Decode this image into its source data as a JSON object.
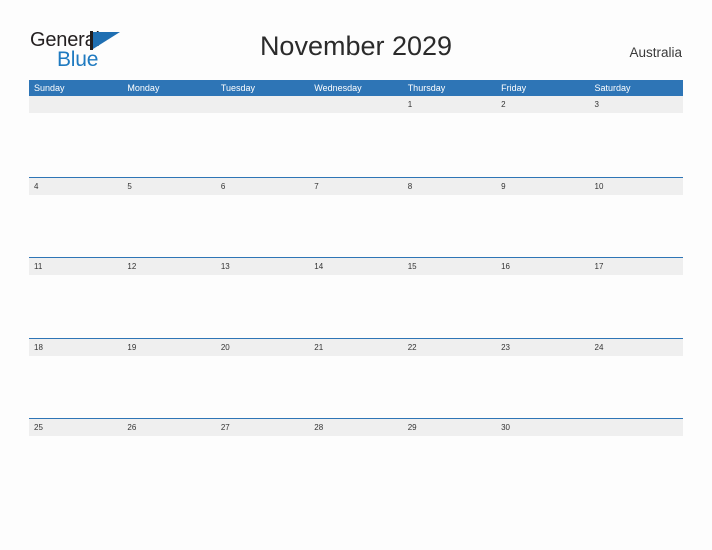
{
  "brand": {
    "name_part1": "General",
    "name_part2": "Blue",
    "triangle_color": "#1f6fb2",
    "blue_text_color": "#1f7ac0"
  },
  "header": {
    "title": "November 2029",
    "region": "Australia"
  },
  "theme": {
    "header_blue": "#2E75B6",
    "rule_blue": "#2E75B6",
    "date_band_gray": "#efefef",
    "page_background": "#fdfdfd",
    "date_text": "#333333",
    "weekday_text": "#ffffff"
  },
  "calendar": {
    "weekday_labels": [
      "Sunday",
      "Monday",
      "Tuesday",
      "Wednesday",
      "Thursday",
      "Friday",
      "Saturday"
    ],
    "weeks": [
      [
        "",
        "",
        "",
        "",
        "1",
        "2",
        "3"
      ],
      [
        "4",
        "5",
        "6",
        "7",
        "8",
        "9",
        "10"
      ],
      [
        "11",
        "12",
        "13",
        "14",
        "15",
        "16",
        "17"
      ],
      [
        "18",
        "19",
        "20",
        "21",
        "22",
        "23",
        "24"
      ],
      [
        "25",
        "26",
        "27",
        "28",
        "29",
        "30",
        ""
      ]
    ]
  }
}
